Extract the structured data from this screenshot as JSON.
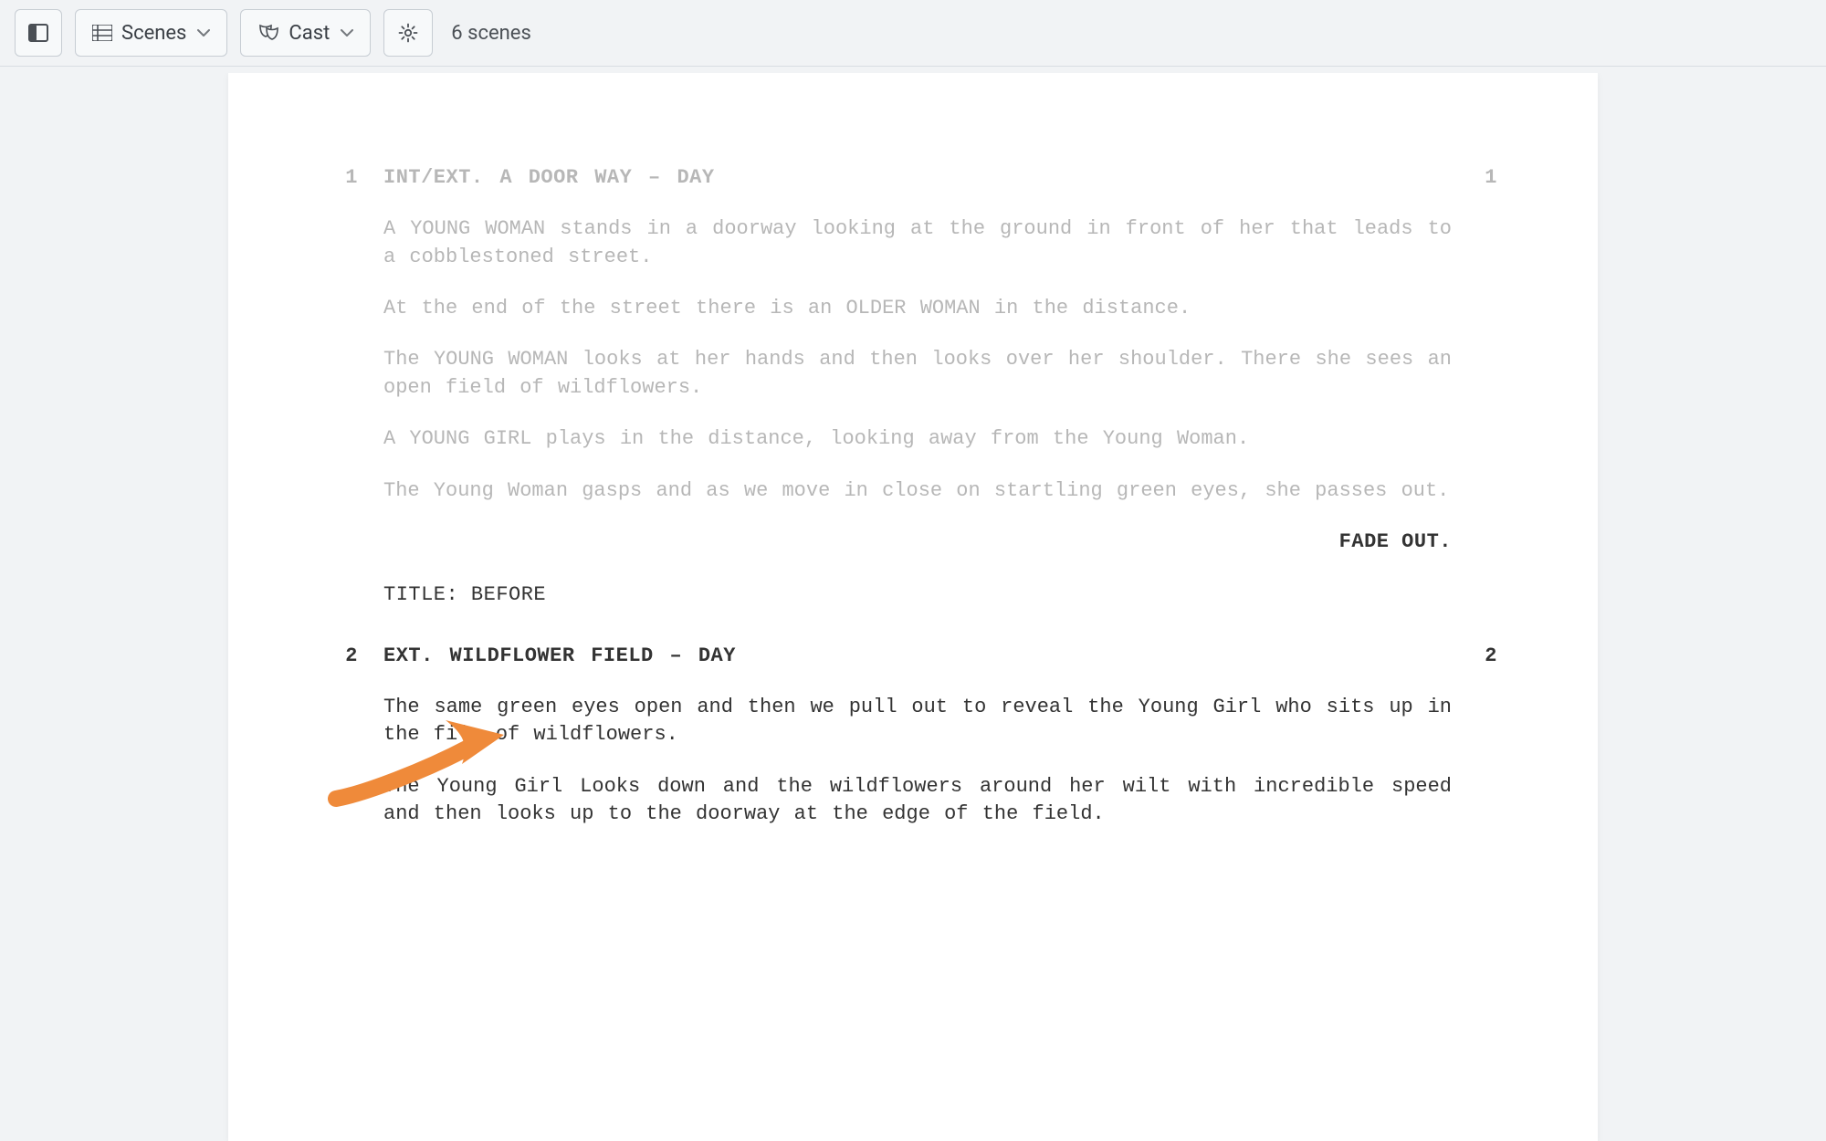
{
  "toolbar": {
    "scenes_label": "Scenes",
    "cast_label": "Cast",
    "scene_count_text": "6 scenes"
  },
  "script": {
    "scene1": {
      "num": "1",
      "heading": "INT/EXT. A DOOR WAY – DAY",
      "p1": "A YOUNG WOMAN stands in a doorway looking at the ground in front of her that leads to a cobblestoned street.",
      "p2": "At the end of the street there is an OLDER WOMAN in the distance.",
      "p3": "The YOUNG WOMAN looks at her hands and then looks over her shoulder. There she sees an open field of wildflowers.",
      "p4": "A YOUNG GIRL plays in the distance, looking away from the Young Woman.",
      "p5": "The Young Woman gasps and as we move in close on startling green eyes, she passes out."
    },
    "transition1": "FADE OUT.",
    "title_card": "TITLE: BEFORE",
    "scene2": {
      "num": "2",
      "heading": "EXT. WILDFLOWER FIELD – DAY",
      "p1": "The same green eyes open and then we pull out to reveal the Young Girl who sits up in the file of wildflowers.",
      "p2": "The Young Girl Looks down and the wildflowers around her wilt with incredible speed and then looks up to the doorway at the edge of the field."
    }
  },
  "annotation": {
    "arrow_color": "#ef8a3a"
  }
}
